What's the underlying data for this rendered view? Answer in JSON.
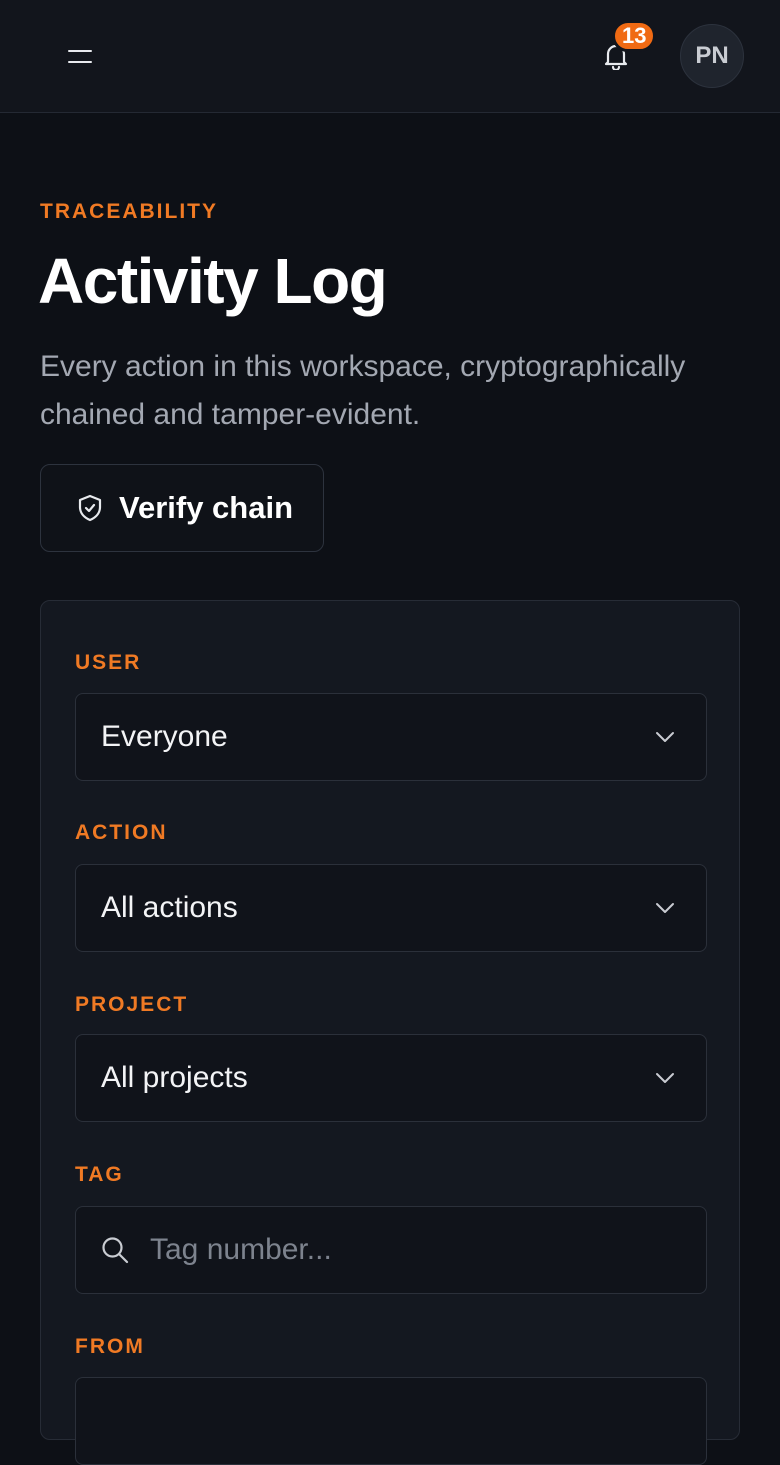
{
  "header": {
    "notification_count": "13",
    "avatar_initials": "PN"
  },
  "page": {
    "eyebrow": "TRACEABILITY",
    "title": "Activity Log",
    "subtitle": "Every action in this workspace, cryptographically chained and tamper-evident.",
    "verify_button_label": "Verify chain"
  },
  "filters": {
    "user": {
      "label": "USER",
      "value": "Everyone"
    },
    "action": {
      "label": "ACTION",
      "value": "All actions"
    },
    "project": {
      "label": "PROJECT",
      "value": "All projects"
    },
    "tag": {
      "label": "TAG",
      "placeholder": "Tag number..."
    },
    "from": {
      "label": "FROM"
    }
  },
  "colors": {
    "accent": "#f07a24",
    "badge": "#f06a13",
    "background": "#0d1016",
    "card": "#141820"
  },
  "icons": [
    "menu-icon",
    "bell-icon",
    "shield-icon",
    "chevron-down-icon",
    "search-icon"
  ]
}
